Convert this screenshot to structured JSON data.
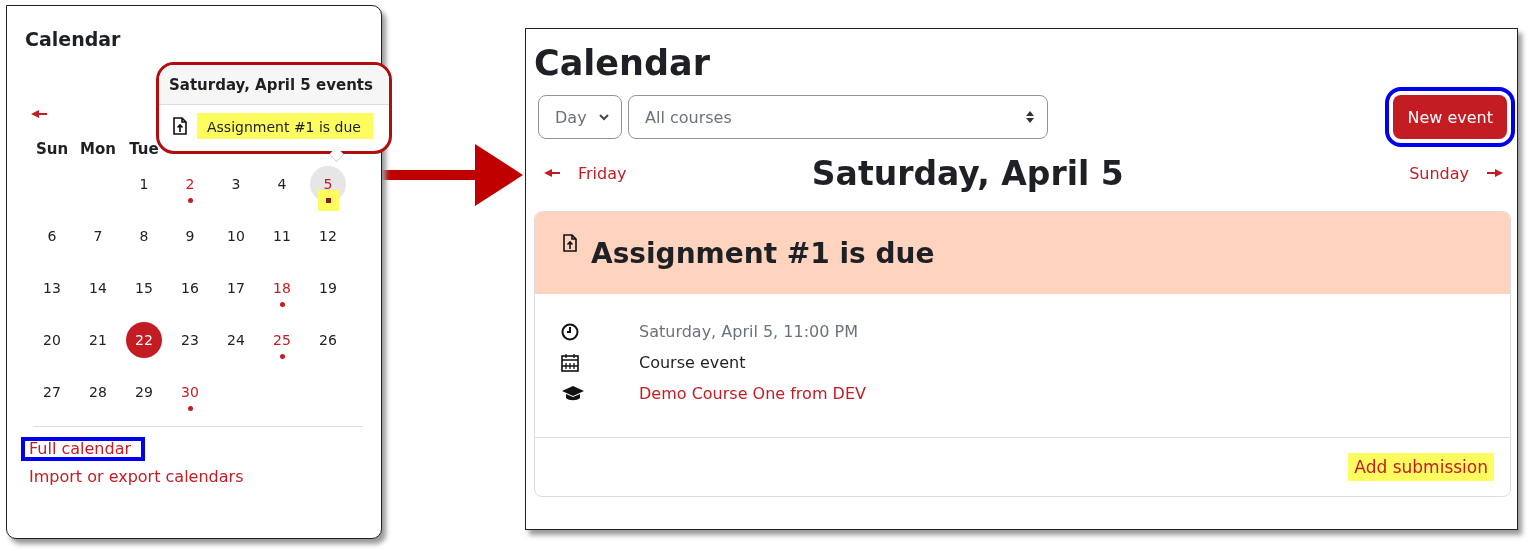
{
  "block": {
    "title": "Calendar",
    "weekdays": [
      "Sun",
      "Mon",
      "Tue"
    ],
    "days": [
      {
        "kind": "blank"
      },
      {
        "kind": "blank"
      },
      {
        "label": "1",
        "event": false,
        "today": false,
        "selected": false
      },
      {
        "label": "2",
        "event": true,
        "today": false,
        "selected": false
      },
      {
        "label": "3",
        "event": false,
        "today": false,
        "selected": false
      },
      {
        "label": "4",
        "event": false,
        "today": false,
        "selected": false
      },
      {
        "label": "5",
        "event": true,
        "today": false,
        "selected": true
      },
      {
        "label": "6",
        "event": false,
        "today": false,
        "selected": false
      },
      {
        "label": "7",
        "event": false,
        "today": false,
        "selected": false
      },
      {
        "label": "8",
        "event": false,
        "today": false,
        "selected": false
      },
      {
        "label": "9",
        "event": false,
        "today": false,
        "selected": false
      },
      {
        "label": "10",
        "event": false,
        "today": false,
        "selected": false
      },
      {
        "label": "11",
        "event": false,
        "today": false,
        "selected": false
      },
      {
        "label": "12",
        "event": false,
        "today": false,
        "selected": false
      },
      {
        "label": "13",
        "event": false,
        "today": false,
        "selected": false
      },
      {
        "label": "14",
        "event": false,
        "today": false,
        "selected": false
      },
      {
        "label": "15",
        "event": false,
        "today": false,
        "selected": false
      },
      {
        "label": "16",
        "event": false,
        "today": false,
        "selected": false
      },
      {
        "label": "17",
        "event": false,
        "today": false,
        "selected": false
      },
      {
        "label": "18",
        "event": true,
        "today": false,
        "selected": false
      },
      {
        "label": "19",
        "event": false,
        "today": false,
        "selected": false
      },
      {
        "label": "20",
        "event": false,
        "today": false,
        "selected": false
      },
      {
        "label": "21",
        "event": false,
        "today": false,
        "selected": false
      },
      {
        "label": "22",
        "event": false,
        "today": true,
        "selected": false
      },
      {
        "label": "23",
        "event": false,
        "today": false,
        "selected": false
      },
      {
        "label": "24",
        "event": false,
        "today": false,
        "selected": false
      },
      {
        "label": "25",
        "event": true,
        "today": false,
        "selected": false
      },
      {
        "label": "26",
        "event": false,
        "today": false,
        "selected": false
      },
      {
        "label": "27",
        "event": false,
        "today": false,
        "selected": false
      },
      {
        "label": "28",
        "event": false,
        "today": false,
        "selected": false
      },
      {
        "label": "29",
        "event": false,
        "today": false,
        "selected": false
      },
      {
        "label": "30",
        "event": true,
        "today": false,
        "selected": false
      }
    ],
    "popover": {
      "title": "Saturday, April 5 events",
      "event": "Assignment #1 is due"
    },
    "links": [
      {
        "label": "Full calendar",
        "outlined": true
      },
      {
        "label": "Import or export calendars",
        "outlined": false
      }
    ]
  },
  "page": {
    "title": "Calendar",
    "view_select": "Day",
    "course_select": "All courses",
    "new_event": "New event",
    "prev": "Friday",
    "day_title": "Saturday, April 5",
    "next": "Sunday",
    "event": {
      "title": "Assignment #1 is due",
      "details": [
        {
          "kind": "time",
          "text": "Saturday, April 5, 11:00 PM"
        },
        {
          "kind": "type",
          "text": "Course event"
        },
        {
          "kind": "course",
          "text": "Demo Course One from DEV"
        }
      ],
      "action": "Add submission"
    }
  }
}
